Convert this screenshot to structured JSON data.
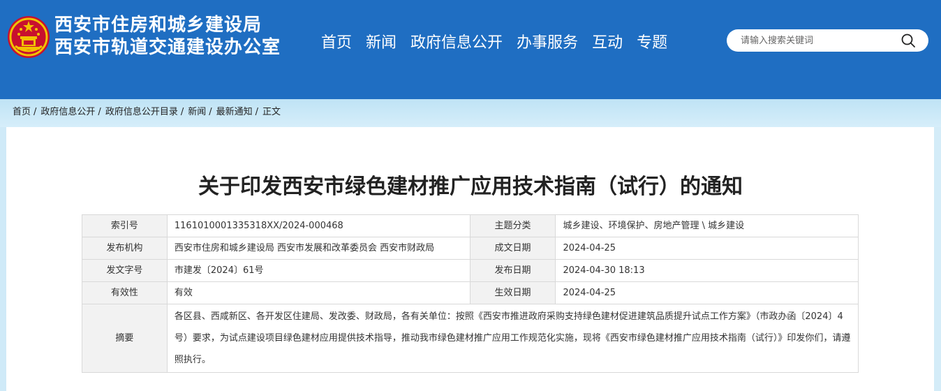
{
  "header": {
    "org_line1": "西安市住房和城乡建设局",
    "org_line2": "西安市轨道交通建设办公室",
    "nav": [
      "首页",
      "新闻",
      "政府信息公开",
      "办事服务",
      "互动",
      "专题"
    ],
    "search_placeholder": "请输入搜索关键词",
    "colors": {
      "bar": "#1f6ec2",
      "text": "#ffffff"
    }
  },
  "breadcrumb": [
    "首页",
    "政府信息公开",
    "政府信息公开目录",
    "新闻",
    "最新通知",
    "正文"
  ],
  "breadcrumb_separator": "/",
  "document": {
    "title": "关于印发西安市绿色建材推广应用技术指南（试行）的通知"
  },
  "info": {
    "index_no_label": "索引号",
    "index_no": "1161010001335318XX/2024-000468",
    "topic_label": "主题分类",
    "topic": "城乡建设、环境保护、房地产管理 \\ 城乡建设",
    "publisher_label": "发布机构",
    "publisher": "西安市住房和城乡建设局 西安市发展和改革委员会 西安市财政局",
    "created_label": "成文日期",
    "created": "2024-04-25",
    "doc_no_label": "发文字号",
    "doc_no": "市建发〔2024〕61号",
    "published_label": "发布日期",
    "published": "2024-04-30 18:13",
    "validity_label": "有效性",
    "validity": "有效",
    "effective_label": "生效日期",
    "effective": "2024-04-25",
    "abstract_label": "摘要",
    "abstract": "各区县、西咸新区、各开发区住建局、发改委、财政局，各有关单位：按照《西安市推进政府采购支持绿色建材促进建筑品质提升试点工作方案》（市政办函〔2024〕4号）要求，为试点建设项目绿色建材应用提供技术指导，推动我市绿色建材推广应用工作规范化实施，现将《西安市绿色建材推广应用技术指南（试行）》印发你们，请遵照执行。"
  },
  "icons": {
    "emblem": "national-emblem-icon",
    "search": "search-icon"
  }
}
